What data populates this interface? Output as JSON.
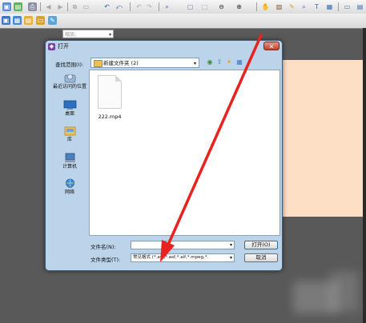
{
  "toolbar": {
    "row1_icons": [
      "new-icon",
      "save-icon",
      "print-icon",
      "back-icon",
      "forward-icon",
      "copy-icon",
      "paste-icon",
      "undo-icon",
      "redo-icon",
      "zoom-icon",
      "fit-page-icon",
      "fit-width-icon",
      "zoom-out-icon",
      "zoom-in-icon",
      "hand-icon",
      "select-icon",
      "pen-icon",
      "find-icon",
      "text-icon",
      "image-icon",
      "window-icon",
      "grid-icon"
    ],
    "combo_placeholder": "缩放:"
  },
  "dialog": {
    "title": "打开",
    "close_symbol": "✕",
    "look_in_label": "查找范围(I):",
    "look_in_value": "新建文件夹 (2)",
    "places": [
      {
        "label": "最近访问的位置",
        "icon": "recent-places-icon"
      },
      {
        "label": "桌面",
        "icon": "desktop-icon"
      },
      {
        "label": "库",
        "icon": "libraries-icon"
      },
      {
        "label": "计算机",
        "icon": "computer-icon"
      },
      {
        "label": "网络",
        "icon": "network-icon"
      }
    ],
    "files": [
      {
        "name": "222.mp4",
        "icon": "file-icon"
      }
    ],
    "file_name_label": "文件名(N):",
    "file_name_value": "",
    "file_type_label": "文件类型(T):",
    "file_type_value": "常见格式 (*.avi,*.asf,*.aif,*.mpeg,*.",
    "open_button": "打开(O)",
    "cancel_button": "取消"
  },
  "colors": {
    "annotation_arrow": "#e8231f",
    "canvas_page": "#fddfc5"
  }
}
